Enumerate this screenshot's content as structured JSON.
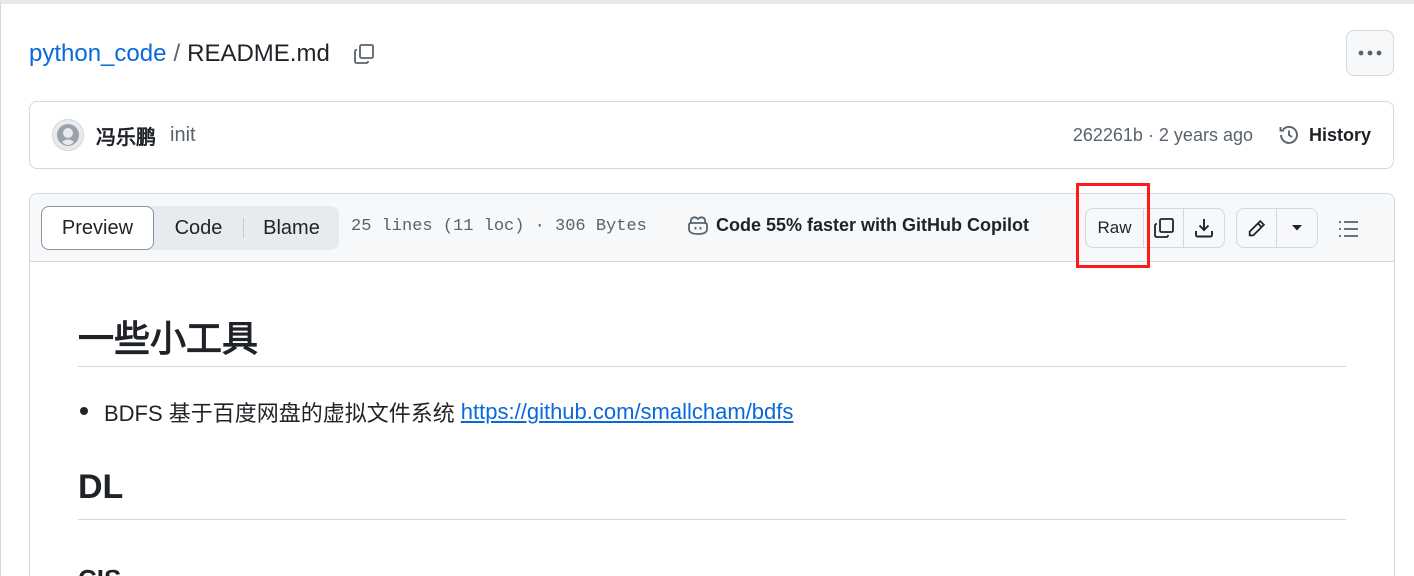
{
  "breadcrumb": {
    "repo": "python_code",
    "separator": "/",
    "file": "README.md"
  },
  "commit": {
    "author": "冯乐鹏",
    "message": "init",
    "meta": "262261b · 2 years ago",
    "history_label": "History"
  },
  "toolbar": {
    "tabs": [
      {
        "label": "Preview",
        "active": true
      },
      {
        "label": "Code",
        "active": false
      },
      {
        "label": "Blame",
        "active": false
      }
    ],
    "file_info": "25 lines (11 loc) · 306 Bytes",
    "copilot_label": "Code 55% faster with GitHub Copilot",
    "raw_label": "Raw"
  },
  "content": {
    "heading1": "一些小工具",
    "list": [
      {
        "text": "BDFS 基于百度网盘的虚拟文件系统",
        "link": "https://github.com/smallcham/bdfs"
      }
    ],
    "heading2": "DL",
    "heading3_partial": "CIS"
  },
  "colors": {
    "link": "#0969da",
    "text": "#1f2328",
    "muted": "#59636e",
    "border": "#d1d9e0",
    "toolbar_bg": "#f6f8fa",
    "highlight": "#ff1a1a"
  },
  "icons": [
    "copy-icon",
    "kebab-icon",
    "avatar-icon",
    "history-icon",
    "copilot-icon",
    "copy-raw-icon",
    "download-icon",
    "pencil-icon",
    "caret-down-icon",
    "outline-list-icon"
  ]
}
